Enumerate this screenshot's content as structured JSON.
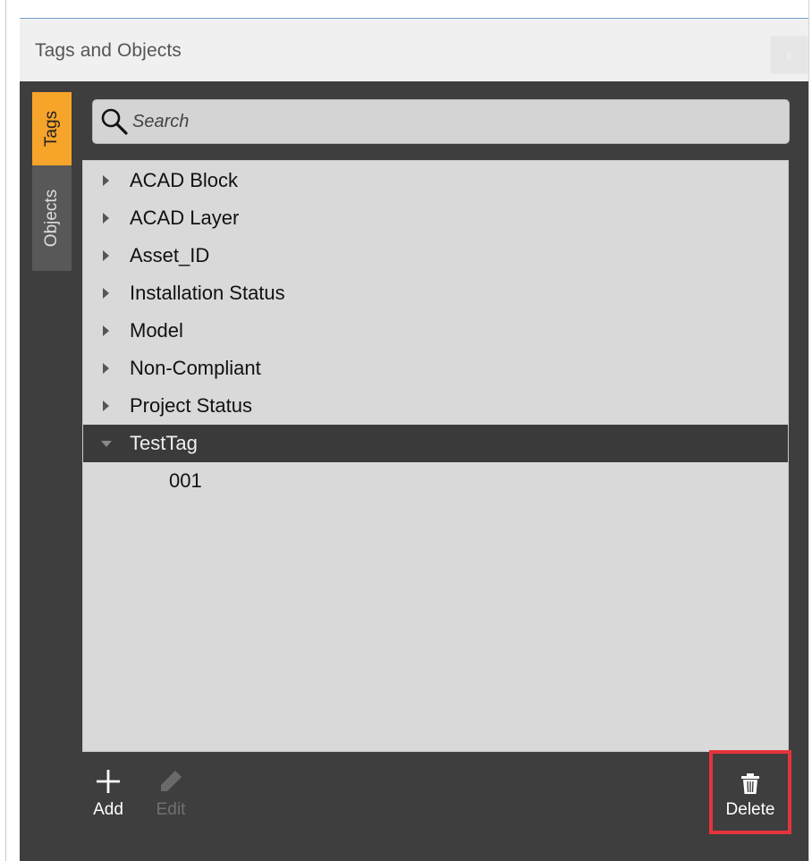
{
  "window": {
    "title": "Tags and Objects",
    "close_label": "x"
  },
  "tabs": [
    {
      "label": "Tags",
      "active": true
    },
    {
      "label": "Objects",
      "active": false
    }
  ],
  "search": {
    "placeholder": "Search",
    "value": ""
  },
  "tree": {
    "items": [
      {
        "label": "ACAD Block",
        "expanded": false
      },
      {
        "label": "ACAD Layer",
        "expanded": false
      },
      {
        "label": "Asset_ID",
        "expanded": false
      },
      {
        "label": "Installation Status",
        "expanded": false
      },
      {
        "label": "Model",
        "expanded": false
      },
      {
        "label": "Non-Compliant",
        "expanded": false
      },
      {
        "label": "Project Status",
        "expanded": false
      },
      {
        "label": "TestTag",
        "expanded": true,
        "selected": true,
        "children": [
          "001"
        ]
      }
    ]
  },
  "toolbar": {
    "add_label": "Add",
    "edit_label": "Edit",
    "delete_label": "Delete",
    "add_icon": "plus-icon",
    "edit_icon": "pencil-icon",
    "delete_icon": "trash-icon"
  },
  "colors": {
    "accent": "#f7a42a",
    "panel": "#3e3e3e",
    "list_bg": "#d9d9d9",
    "highlight_border": "#e5343a"
  }
}
